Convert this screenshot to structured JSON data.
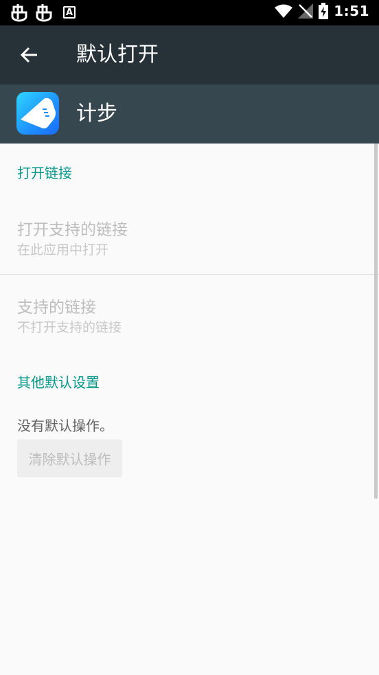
{
  "status_bar": {
    "time": "1:51",
    "icons": [
      "bug-icon",
      "bug-icon",
      "a-notification-icon",
      "wifi-icon",
      "no-signal-icon",
      "battery-charging-icon"
    ],
    "a_icon_letter": "A"
  },
  "toolbar": {
    "title": "默认打开",
    "back_icon": "arrow-left-icon"
  },
  "app": {
    "name": "计步",
    "icon": "sneaker-icon"
  },
  "sections": {
    "open_links": {
      "header": "打开链接",
      "open_supported": {
        "title": "打开支持的链接",
        "subtitle": "在此应用中打开"
      },
      "supported_links": {
        "title": "支持的链接",
        "subtitle": "不打开支持的链接"
      }
    },
    "other_defaults": {
      "header": "其他默认设置",
      "no_default_text": "没有默认操作。",
      "clear_button_label": "清除默认操作"
    }
  },
  "colors": {
    "status_bar": "#000000",
    "toolbar": "#263238",
    "app_header": "#37474f",
    "accent": "#009688",
    "background": "#fafafa"
  }
}
